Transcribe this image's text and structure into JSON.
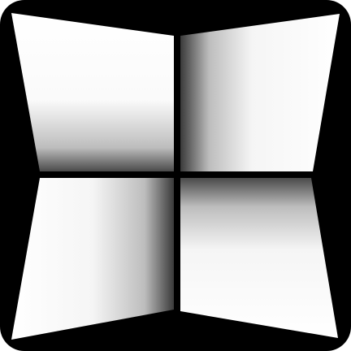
{
  "icon": {
    "name": "four-pane-window-icon",
    "colors": {
      "frame": "#000000",
      "pane_light": "#ffffff",
      "pane_dark": "#3a3a3a"
    }
  }
}
